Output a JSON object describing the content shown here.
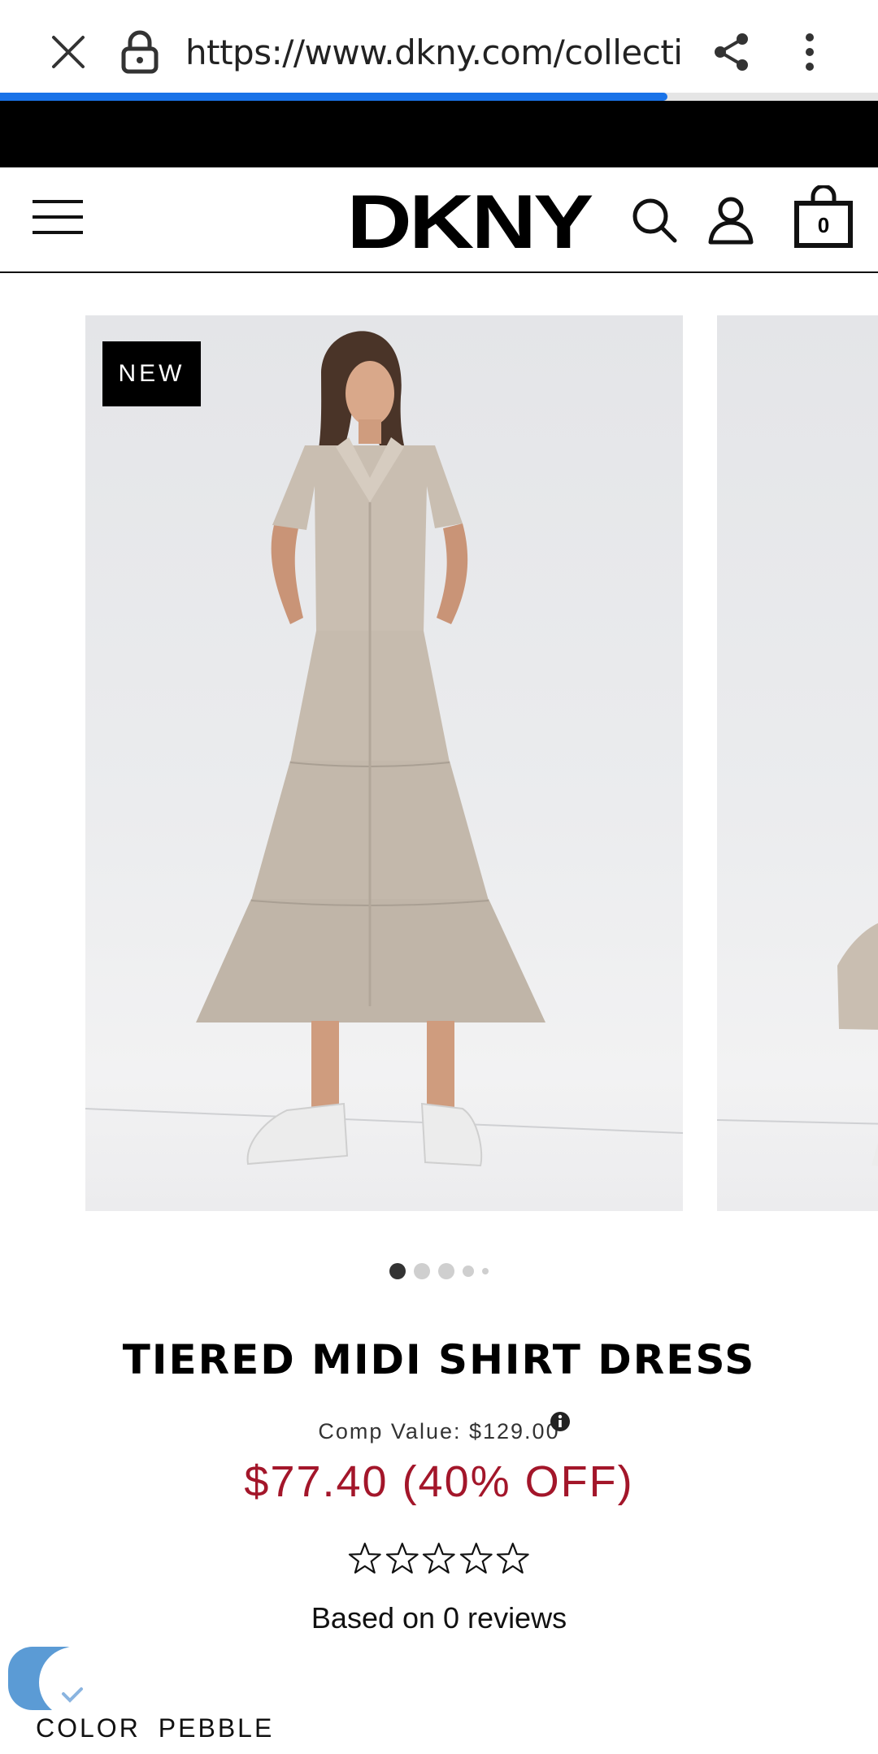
{
  "browser": {
    "url": "https://www.dkny.com/collectio",
    "load_progress": 0.76,
    "progress_color": "#1a73e8"
  },
  "header": {
    "logo": "DKNY",
    "bag_count": "0"
  },
  "carousel": {
    "badge": "NEW",
    "slide_count": 5,
    "active_index": 0
  },
  "product": {
    "title": "TIERED MIDI SHIRT DRESS",
    "comp_value": "Comp Value: $129.00",
    "price": "$77.40 (40% OFF)",
    "price_color": "#a3162a",
    "rating": 0,
    "rating_max": 5,
    "reviews": "Based on 0 reviews",
    "color_label": "COLOR",
    "color_value": "PEBBLE"
  },
  "icons": [
    "close-icon",
    "lock-icon",
    "share-icon",
    "more-vert-icon",
    "hamburger-menu-icon",
    "search-icon",
    "account-icon",
    "shopping-bag-icon",
    "info-icon",
    "star-outline-icon"
  ]
}
